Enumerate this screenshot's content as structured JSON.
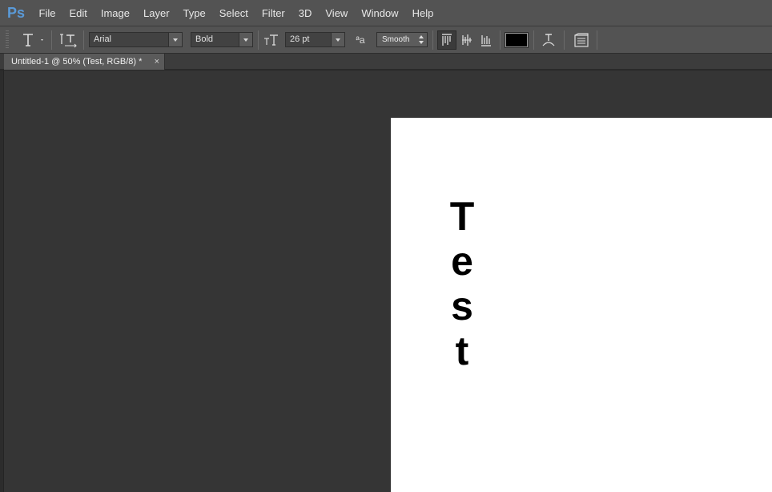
{
  "app": {
    "logo": "Ps"
  },
  "menu": [
    "File",
    "Edit",
    "Image",
    "Layer",
    "Type",
    "Select",
    "Filter",
    "3D",
    "View",
    "Window",
    "Help"
  ],
  "options": {
    "font_family": "Arial",
    "font_style": "Bold",
    "font_size": "26 pt",
    "antialias_icon_label": "ªa",
    "antialias": "Smooth",
    "text_color": "#000000"
  },
  "document": {
    "tab_title": "Untitled-1 @ 50% (Test, RGB/8) *",
    "close_glyph": "×",
    "text_letters": [
      "T",
      "e",
      "s",
      "t"
    ]
  },
  "icons": [
    "type-tool-icon",
    "toggle-orientation-icon",
    "font-size-icon",
    "antialias-icon",
    "align-left-icon",
    "align-center-icon",
    "align-right-icon",
    "warp-text-icon",
    "character-panel-icon"
  ]
}
